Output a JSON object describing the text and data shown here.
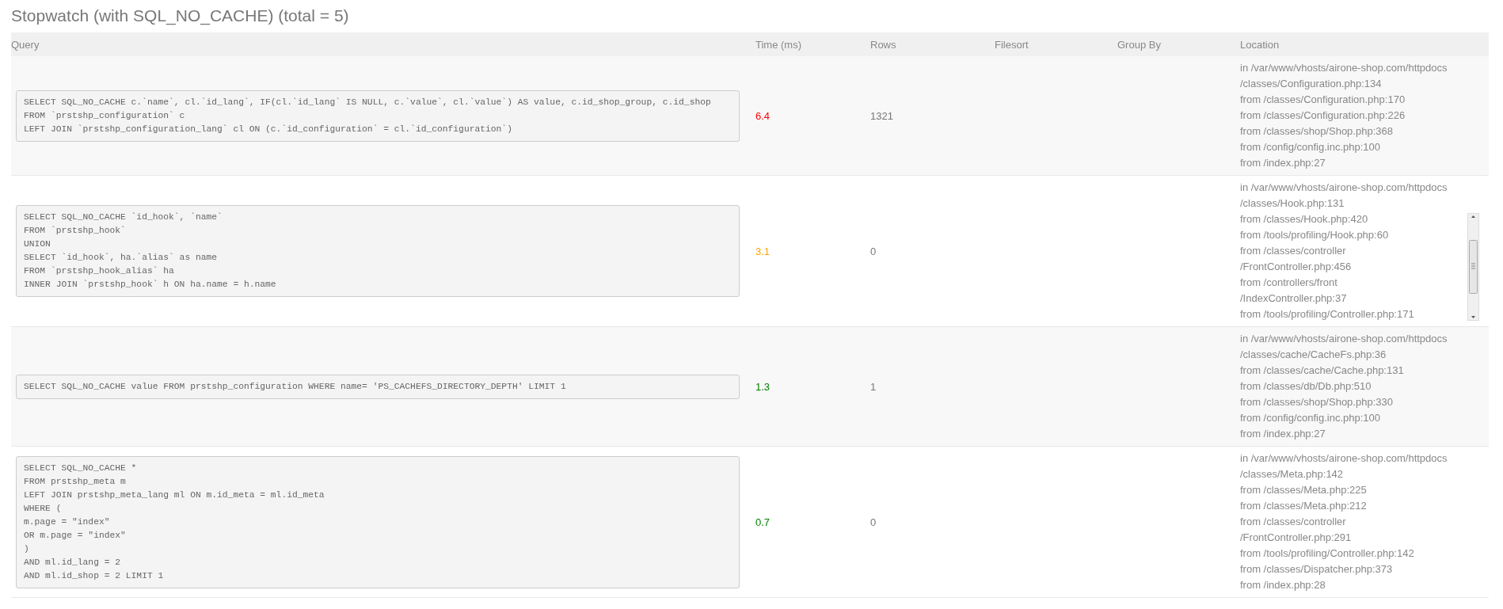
{
  "title": "Stopwatch (with SQL_NO_CACHE) (total = 5)",
  "table": {
    "columns": [
      "Query",
      "Time (ms)",
      "Rows",
      "Filesort",
      "Group By",
      "Location"
    ],
    "rows": [
      {
        "query": "SELECT SQL_NO_CACHE c.`name`, cl.`id_lang`, IF(cl.`id_lang` IS NULL, c.`value`, cl.`value`) AS value, c.id_shop_group, c.id_shop\nFROM `prstshp_configuration` c\nLEFT JOIN `prstshp_configuration_lang` cl ON (c.`id_configuration` = cl.`id_configuration`)",
        "time": "6.4",
        "color": "#ff0000",
        "rows": "1321",
        "location": [
          "in /var/www/vhosts/airone-shop.com/httpdocs",
          "/classes/Configuration.php:134",
          "from /classes/Configuration.php:170",
          "from /classes/Configuration.php:226",
          "from /classes/shop/Shop.php:368",
          "from /config/config.inc.php:100",
          "from /index.php:27"
        ]
      },
      {
        "query": "SELECT SQL_NO_CACHE `id_hook`, `name`\nFROM `prstshp_hook`\nUNION\nSELECT `id_hook`, ha.`alias` as name\nFROM `prstshp_hook_alias` ha\nINNER JOIN `prstshp_hook` h ON ha.name = h.name",
        "time": "3.1",
        "color": "#ffa500",
        "rows": "0",
        "location": [
          "in /var/www/vhosts/airone-shop.com/httpdocs",
          "/classes/Hook.php:131"
        ],
        "location_scroll": [
          "from /classes/Hook.php:420",
          "from /tools/profiling/Hook.php:60",
          "from /classes/controller",
          "/FrontController.php:456",
          "from /controllers/front",
          "/IndexController.php:37",
          "from /tools/profiling/Controller.php:171"
        ]
      },
      {
        "query": "SELECT SQL_NO_CACHE value FROM prstshp_configuration WHERE name= 'PS_CACHEFS_DIRECTORY_DEPTH' LIMIT 1",
        "time": "1.3",
        "color": "#008000",
        "rows": "1",
        "location": [
          "in /var/www/vhosts/airone-shop.com/httpdocs",
          "/classes/cache/CacheFs.php:36",
          "from /classes/cache/Cache.php:131",
          "from /classes/db/Db.php:510",
          "from /classes/shop/Shop.php:330",
          "from /config/config.inc.php:100",
          "from /index.php:27"
        ]
      },
      {
        "query": "SELECT SQL_NO_CACHE *\nFROM prstshp_meta m\nLEFT JOIN prstshp_meta_lang ml ON m.id_meta = ml.id_meta\nWHERE (\nm.page = \"index\"\nOR m.page = \"index\"\n)\nAND ml.id_lang = 2\nAND ml.id_shop = 2 LIMIT 1",
        "time": "0.7",
        "color": "#008000",
        "rows": "0",
        "location": [
          "in /var/www/vhosts/airone-shop.com/httpdocs",
          "/classes/Meta.php:142",
          "from /classes/Meta.php:225",
          "from /classes/Meta.php:212",
          "from /classes/controller",
          "/FrontController.php:291",
          "from /tools/profiling/Controller.php:142",
          "from /classes/Dispatcher.php:373",
          "from /index.php:28"
        ]
      }
    ]
  }
}
